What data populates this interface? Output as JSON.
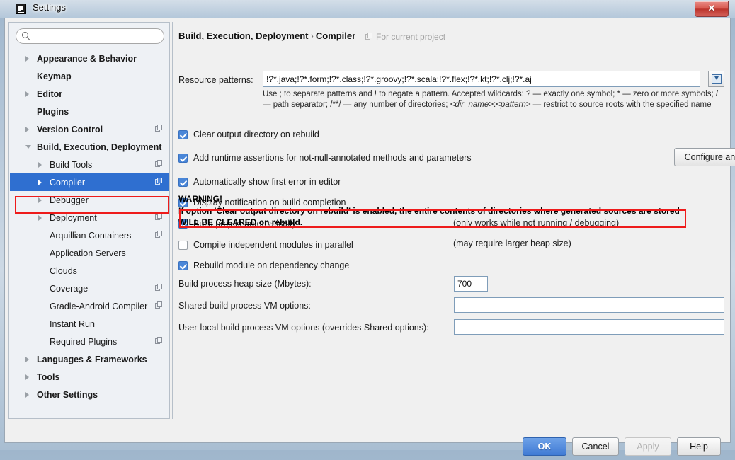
{
  "window": {
    "title": "Settings",
    "icon": "intellij-logo-icon",
    "close_label": "✕"
  },
  "sidebar": {
    "search": {
      "value": "",
      "placeholder": "",
      "icon": "search-icon"
    },
    "items": [
      {
        "label": "Appearance & Behavior",
        "level": 0,
        "bold": true,
        "arrow": "right",
        "scope_icon": false,
        "selected": false
      },
      {
        "label": "Keymap",
        "level": 0,
        "bold": true,
        "arrow": "none",
        "scope_icon": false,
        "selected": false
      },
      {
        "label": "Editor",
        "level": 0,
        "bold": true,
        "arrow": "right",
        "scope_icon": false,
        "selected": false
      },
      {
        "label": "Plugins",
        "level": 0,
        "bold": true,
        "arrow": "none",
        "scope_icon": false,
        "selected": false
      },
      {
        "label": "Version Control",
        "level": 0,
        "bold": true,
        "arrow": "right",
        "scope_icon": true,
        "selected": false
      },
      {
        "label": "Build, Execution, Deployment",
        "level": 0,
        "bold": true,
        "arrow": "down",
        "scope_icon": false,
        "selected": false
      },
      {
        "label": "Build Tools",
        "level": 1,
        "bold": false,
        "arrow": "right",
        "scope_icon": true,
        "selected": false
      },
      {
        "label": "Compiler",
        "level": 1,
        "bold": false,
        "arrow": "right",
        "scope_icon": true,
        "selected": true
      },
      {
        "label": "Debugger",
        "level": 1,
        "bold": false,
        "arrow": "right",
        "scope_icon": false,
        "selected": false
      },
      {
        "label": "Deployment",
        "level": 1,
        "bold": false,
        "arrow": "right",
        "scope_icon": true,
        "selected": false
      },
      {
        "label": "Arquillian Containers",
        "level": 1,
        "bold": false,
        "arrow": "none",
        "scope_icon": true,
        "selected": false
      },
      {
        "label": "Application Servers",
        "level": 1,
        "bold": false,
        "arrow": "none",
        "scope_icon": false,
        "selected": false
      },
      {
        "label": "Clouds",
        "level": 1,
        "bold": false,
        "arrow": "none",
        "scope_icon": false,
        "selected": false
      },
      {
        "label": "Coverage",
        "level": 1,
        "bold": false,
        "arrow": "none",
        "scope_icon": true,
        "selected": false
      },
      {
        "label": "Gradle-Android Compiler",
        "level": 1,
        "bold": false,
        "arrow": "none",
        "scope_icon": true,
        "selected": false
      },
      {
        "label": "Instant Run",
        "level": 1,
        "bold": false,
        "arrow": "none",
        "scope_icon": false,
        "selected": false
      },
      {
        "label": "Required Plugins",
        "level": 1,
        "bold": false,
        "arrow": "none",
        "scope_icon": true,
        "selected": false
      },
      {
        "label": "Languages & Frameworks",
        "level": 0,
        "bold": true,
        "arrow": "right",
        "scope_icon": false,
        "selected": false
      },
      {
        "label": "Tools",
        "level": 0,
        "bold": true,
        "arrow": "right",
        "scope_icon": false,
        "selected": false
      },
      {
        "label": "Other Settings",
        "level": 0,
        "bold": true,
        "arrow": "right",
        "scope_icon": false,
        "selected": false
      }
    ]
  },
  "content": {
    "breadcrumb_parent": "Build, Execution, Deployment",
    "breadcrumb_separator": "›",
    "breadcrumb_current": "Compiler",
    "scope_note": "For current project",
    "resource_patterns": {
      "label": "Resource patterns:",
      "value": "!?*.java;!?*.form;!?*.class;!?*.groovy;!?*.scala;!?*.flex;!?*.kt;!?*.clj;!?*.aj",
      "placeholder": "",
      "browse_icon": "expand-editor-icon",
      "help_part1": "Use ; to separate patterns and ! to negate a pattern. Accepted wildcards: ? — exactly one symbol; * — zero or more symbols; / — path separator; /**/ — any number of directories; ",
      "help_dir": "<dir_name>",
      "help_colon": ":",
      "help_pattern": "<pattern>",
      "help_part2": " — restrict to source roots with the specified name"
    },
    "checkboxes": [
      {
        "label": "Clear output directory on rebuild",
        "checked": true,
        "mnemonic": "l"
      },
      {
        "label": "Add runtime assertions for not-null-annotated methods and parameters",
        "checked": true,
        "mnemonic": "a"
      },
      {
        "label": "Automatically show first error in editor",
        "checked": true,
        "mnemonic": "e"
      },
      {
        "label": "Display notification on build completion",
        "checked": true,
        "mnemonic": ""
      },
      {
        "label": "Build project automatically",
        "checked": true,
        "mnemonic": ""
      },
      {
        "label": "Compile independent modules in parallel",
        "checked": false,
        "mnemonic": "l"
      },
      {
        "label": "Rebuild module on dependency change",
        "checked": true,
        "mnemonic": ""
      }
    ],
    "configure_annotations_button": "Configure annotations...",
    "hint_auto_build": "(only works while not running / debugging)",
    "hint_parallel": "(may require larger heap size)",
    "fields": [
      {
        "label": "Build process heap size (Mbytes):",
        "value": "700",
        "placeholder": ""
      },
      {
        "label": "Shared build process VM options:",
        "value": "",
        "placeholder": ""
      },
      {
        "label": "User-local build process VM options (overrides Shared options):",
        "value": "",
        "placeholder": ""
      }
    ],
    "warning": {
      "heading": "WARNING!",
      "line1": "If option 'Clear output directory on rebuild' is enabled, the entire contents of directories where generated sources are stored",
      "line2": "WILL BE CLEARED on rebuild."
    }
  },
  "buttons": {
    "ok": "OK",
    "cancel": "Cancel",
    "apply": "Apply",
    "help": "Help"
  },
  "annotations": {
    "highlight_color": "#ee1b1b",
    "selection_color": "#2f6fd0",
    "checkbox_color": "#4a86d8"
  }
}
